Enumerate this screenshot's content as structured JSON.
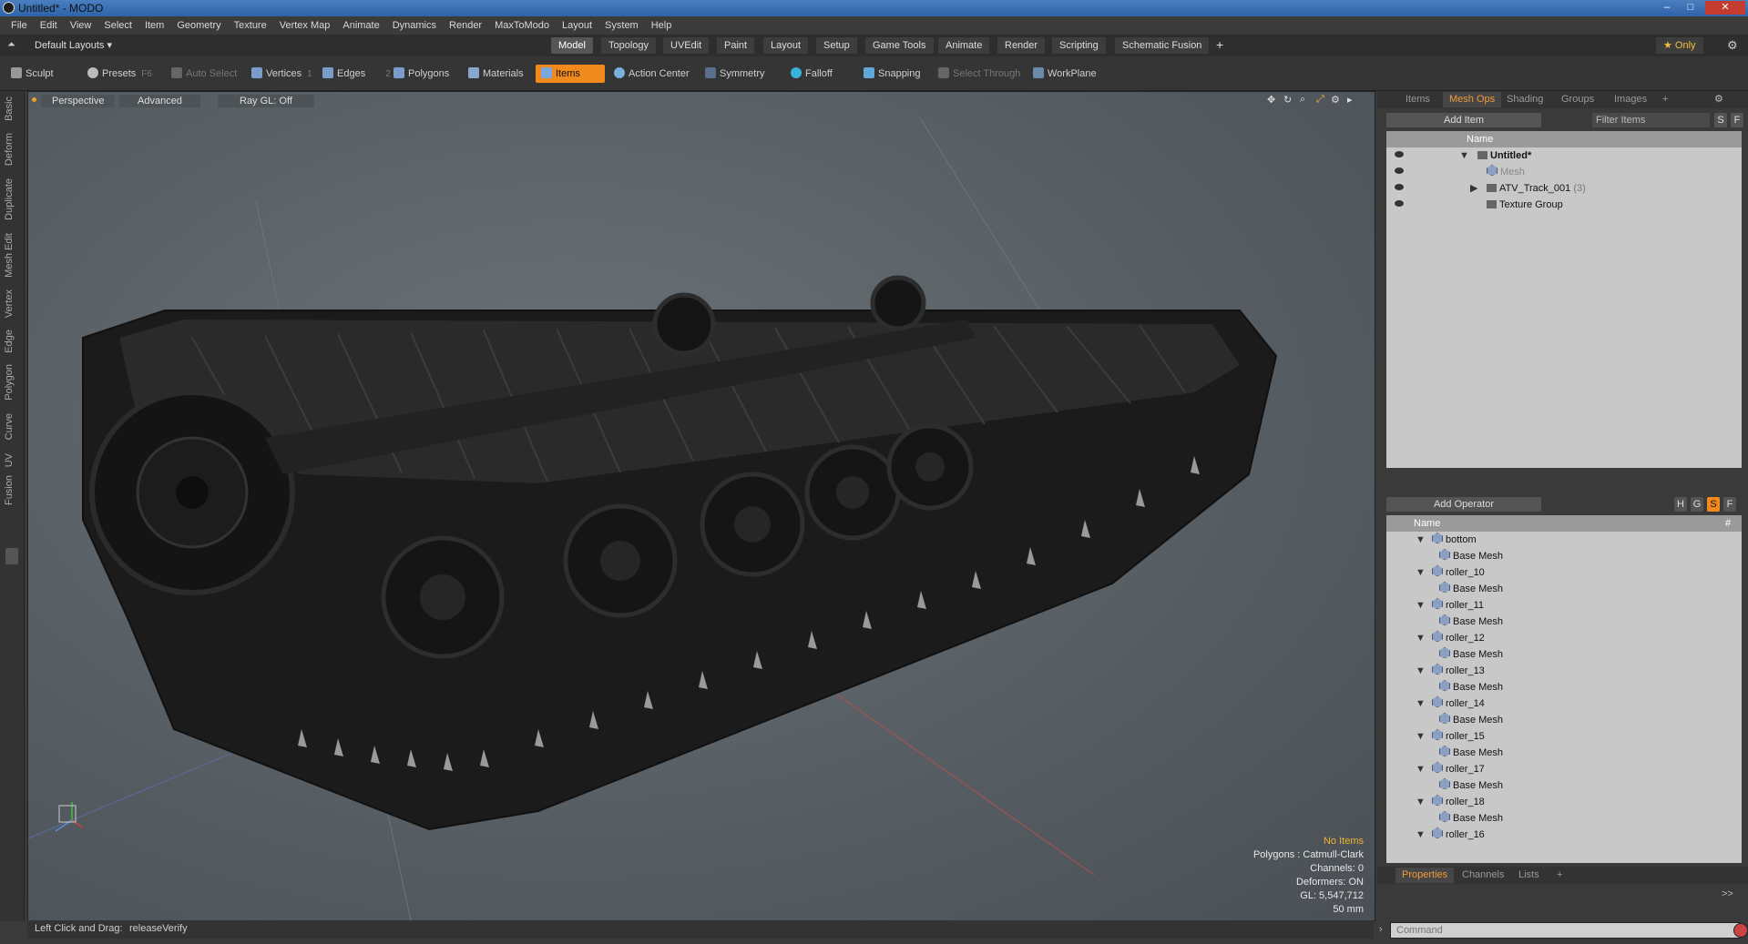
{
  "window": {
    "title": "Untitled* - MODO",
    "min": "–",
    "max": "□",
    "close": "✕"
  },
  "menu": [
    "File",
    "Edit",
    "View",
    "Select",
    "Item",
    "Geometry",
    "Texture",
    "Vertex Map",
    "Animate",
    "Dynamics",
    "Render",
    "MaxToModo",
    "Layout",
    "System",
    "Help"
  ],
  "layoutbar": {
    "layout_label": "Default Layouts ▾",
    "tabs": [
      "Model",
      "Topology",
      "UVEdit",
      "Paint",
      "Layout",
      "Setup",
      "Game Tools",
      "Animate",
      "Render",
      "Scripting",
      "Schematic Fusion"
    ],
    "active_tab": "Model",
    "add": "+",
    "only_label": "★ Only"
  },
  "toolbar": {
    "sculpt": "Sculpt",
    "presets": "Presets",
    "presets_hotkey": "F6",
    "auto_select": "Auto Select",
    "vertices": "Vertices",
    "vertices_hotkey": "1",
    "edges": "Edges",
    "edges_hotkey": "2",
    "polygons": "Polygons",
    "materials": "Materials",
    "items": "Items",
    "action_center": "Action Center",
    "symmetry": "Symmetry",
    "falloff": "Falloff",
    "snapping": "Snapping",
    "select_through": "Select Through",
    "workplane": "WorkPlane"
  },
  "leftbar": [
    "Basic",
    "Deform",
    "Duplicate",
    "Mesh Edit",
    "Vertex",
    "Edge",
    "Polygon",
    "Curve",
    "UV",
    "Fusion"
  ],
  "viewport": {
    "perspective": "Perspective",
    "advanced": "Advanced",
    "raygl": "Ray GL: Off",
    "hud": {
      "no_items": "No Items",
      "polygons": "Polygons : Catmull-Clark",
      "channels": "Channels: 0",
      "deformers": "Deformers: ON",
      "gl": "GL: 5,547,712",
      "units": "50 mm"
    },
    "accent_color": "#f0b030"
  },
  "status": {
    "hint_label": "Left Click and Drag:",
    "hint_value": "releaseVerify"
  },
  "rpanel": {
    "tabs": [
      "Items",
      "Mesh Ops",
      "Shading",
      "Groups",
      "Images"
    ],
    "active_tab": "Mesh Ops",
    "add_item": "Add Item",
    "filter_items": "Filter Items",
    "s_btn": "S",
    "f_btn": "F",
    "name_col": "Name",
    "items": [
      {
        "label": "Untitled*",
        "bold": true
      },
      {
        "label": "Mesh",
        "dim": true
      },
      {
        "label": "ATV_Track_001",
        "suffix": "(3)"
      },
      {
        "label": "Texture Group"
      }
    ],
    "add_operator": "Add Operator",
    "op_buttons": [
      "H",
      "G",
      "S",
      "F"
    ],
    "ops_name_col": "Name",
    "ops_count_col": "#",
    "ops": [
      {
        "label": "bottom",
        "child": "Base Mesh"
      },
      {
        "label": "roller_10",
        "child": "Base Mesh"
      },
      {
        "label": "roller_11",
        "child": "Base Mesh"
      },
      {
        "label": "roller_12",
        "child": "Base Mesh"
      },
      {
        "label": "roller_13",
        "child": "Base Mesh"
      },
      {
        "label": "roller_14",
        "child": "Base Mesh"
      },
      {
        "label": "roller_15",
        "child": "Base Mesh"
      },
      {
        "label": "roller_17",
        "child": "Base Mesh"
      },
      {
        "label": "roller_18",
        "child": "Base Mesh"
      },
      {
        "label": "roller_16",
        "child": null
      }
    ],
    "bottom_tabs": [
      "Properties",
      "Channels",
      "Lists"
    ],
    "bottom_active": "Properties",
    "expand": ">>",
    "command_placeholder": "Command"
  }
}
